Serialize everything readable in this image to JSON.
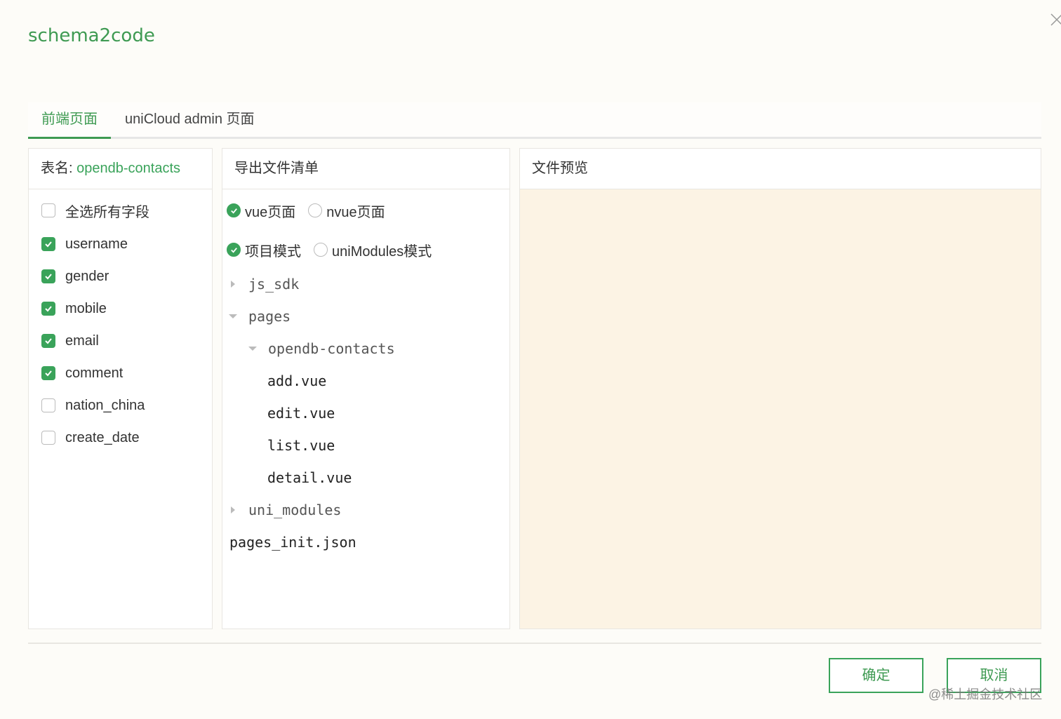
{
  "app_title": "schema2code",
  "tabs": [
    {
      "label": "前端页面",
      "active": true
    },
    {
      "label": "uniCloud admin 页面",
      "active": false
    }
  ],
  "fields_panel": {
    "table_prefix": "表名:",
    "table_name": "opendb-contacts",
    "select_all_label": "全选所有字段",
    "fields": [
      {
        "label": "username",
        "checked": true
      },
      {
        "label": "gender",
        "checked": true
      },
      {
        "label": "mobile",
        "checked": true
      },
      {
        "label": "email",
        "checked": true
      },
      {
        "label": "comment",
        "checked": true
      },
      {
        "label": "nation_china",
        "checked": false
      },
      {
        "label": "create_date",
        "checked": false
      }
    ]
  },
  "export_panel": {
    "header": "导出文件清单",
    "page_type": {
      "option1": "vue页面",
      "option2": "nvue页面",
      "selected": "vue页面"
    },
    "mode": {
      "option1": "项目模式",
      "option2": "uniModules模式",
      "selected": "项目模式"
    },
    "tree": [
      {
        "label": "js_sdk",
        "type": "folder",
        "expanded": false
      },
      {
        "label": "pages",
        "type": "folder",
        "expanded": true
      },
      {
        "label": "opendb-contacts",
        "type": "folder",
        "expanded": true
      },
      {
        "label": "add.vue",
        "type": "file"
      },
      {
        "label": "edit.vue",
        "type": "file"
      },
      {
        "label": "list.vue",
        "type": "file"
      },
      {
        "label": "detail.vue",
        "type": "file"
      },
      {
        "label": "uni_modules",
        "type": "folder",
        "expanded": false
      },
      {
        "label": "pages_init.json",
        "type": "file"
      }
    ]
  },
  "preview_panel": {
    "header": "文件预览"
  },
  "buttons": {
    "confirm": "确定",
    "cancel": "取消"
  },
  "watermark": "@稀土掘金技术社区",
  "colors": {
    "accent": "#3aa35a",
    "title": "#3e9a52",
    "preview_bg": "#fcf3e4"
  },
  "icons": [
    "close-icon",
    "checkbox-check-icon",
    "radio-check-icon",
    "caret-right-icon",
    "caret-down-icon"
  ]
}
